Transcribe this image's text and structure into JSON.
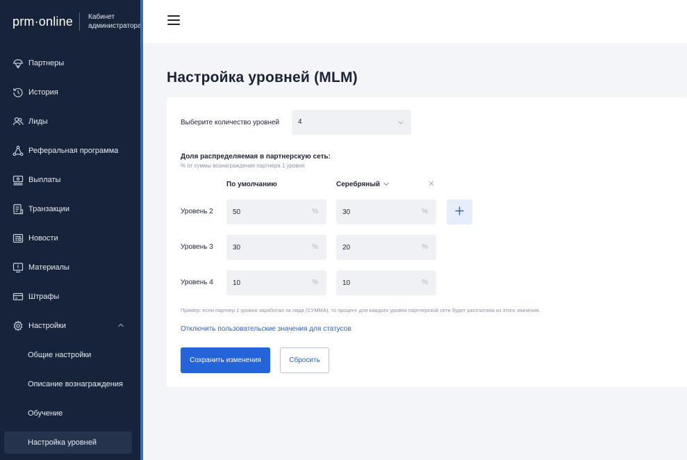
{
  "sidebar": {
    "logo": "prm·online",
    "subtitle": "Кабинет\nадминистратора",
    "items": [
      {
        "label": "Партнеры",
        "icon": "handshake-icon"
      },
      {
        "label": "История",
        "icon": "history-icon"
      },
      {
        "label": "Лиды",
        "icon": "users-icon"
      },
      {
        "label": "Реферальная программа",
        "icon": "share-nodes-icon"
      },
      {
        "label": "Выплаты",
        "icon": "payouts-icon"
      },
      {
        "label": "Транзакции",
        "icon": "transactions-icon"
      },
      {
        "label": "Новости",
        "icon": "newspaper-icon"
      },
      {
        "label": "Материалы",
        "icon": "materials-icon"
      },
      {
        "label": "Штрафы",
        "icon": "card-icon"
      },
      {
        "label": "Настройки",
        "icon": "gear-icon",
        "expanded": true
      }
    ],
    "settings_subitems": [
      {
        "label": "Общие настройки"
      },
      {
        "label": "Описание вознаграждения"
      },
      {
        "label": "Обучение"
      },
      {
        "label": "Настройка уровней",
        "active": true
      }
    ]
  },
  "header": {
    "menu_icon": "hamburger-icon"
  },
  "page": {
    "title": "Настройка уровней (MLM)",
    "levels_count_label": "Выберите количество уровней",
    "levels_count_value": "4",
    "share_title": "Доля распределяемая в партнерскую сеть:",
    "share_subtitle": "% от суммы вознаграждения партнера 1 уровня",
    "columns": {
      "default": "По умолчанию",
      "status": "Серебряный"
    },
    "percent_sign": "%",
    "rows": [
      {
        "label": "Уровень 2",
        "default": "50",
        "status": "30"
      },
      {
        "label": "Уровень 3",
        "default": "30",
        "status": "20"
      },
      {
        "label": "Уровень 4",
        "default": "10",
        "status": "10"
      }
    ],
    "note": "Пример: если партнер 1 уровня заработал за лида (СУММА), то процент для каждого уровня партнерской сети будет рассчитана из этого значения.",
    "disable_link": "Отключить пользовательские значения для статусов",
    "save_button": "Сохранить изменения",
    "reset_button": "Сбросить"
  },
  "colors": {
    "sidebar_bg": "#17233a",
    "accent": "#2563d8",
    "link": "#2c61c4",
    "page_bg": "#f4f5f8"
  }
}
